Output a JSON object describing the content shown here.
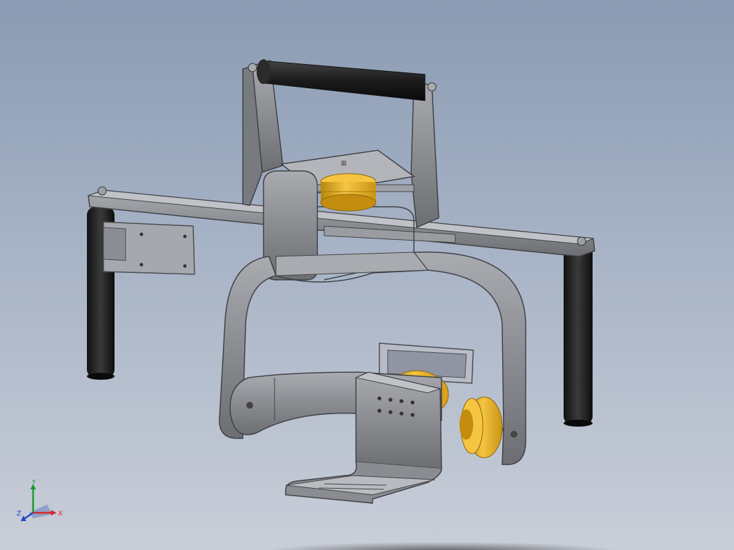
{
  "viewport": {
    "background_top": "#8a9bb3",
    "background_bottom": "#c9ced8"
  },
  "model": {
    "part_colors": {
      "frame": "#8d8f94",
      "frame_dark": "#5e6065",
      "frame_light": "#b5b7bc",
      "motor": "#e8b21e",
      "grip": "#222222",
      "board": "#9aa0ad"
    },
    "icon": "gimbal-3d-model"
  },
  "triad": {
    "x_label": "X",
    "y_label": "Y",
    "z_label": "Z",
    "x_color": "#d9282a",
    "y_color": "#1a9a2a",
    "z_color": "#2045c8"
  }
}
